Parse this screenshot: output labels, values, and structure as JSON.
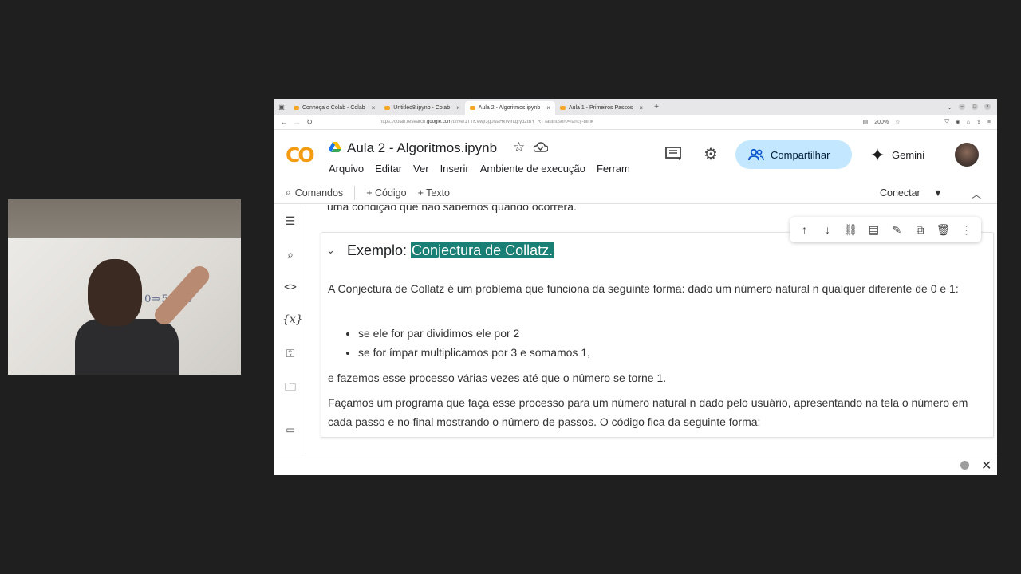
{
  "browser": {
    "tabs": [
      {
        "label": "Conheça o Colab - Colab",
        "active": false
      },
      {
        "label": "Untitled8.ipynb - Colab",
        "active": false
      },
      {
        "label": "Aula 2 - Algoritmos.ipynb",
        "active": true
      },
      {
        "label": "Aula 1 - Primeiros Passos",
        "active": false
      }
    ],
    "new_tab": "+",
    "url_prefix": "https://colab.research.",
    "url_domain": "google.com",
    "url_rest": "/drive/1TTKVwjf3g0NaHkWIntgryd2fBY_RT?authuser0=fancy-blink",
    "zoom": "200%"
  },
  "header": {
    "logo_text": "CO",
    "title": "Aula 2 - Algoritmos.ipynb",
    "menu": [
      "Arquivo",
      "Editar",
      "Ver",
      "Inserir",
      "Ambiente de execução",
      "Ferram"
    ],
    "share_label": "Compartilhar",
    "gemini_label": "Gemini",
    "accent_color": "#f9ab00",
    "share_bg": "#c2e7ff"
  },
  "toolbar": {
    "commands": "Comandos",
    "code": "+ Código",
    "text": "+ Texto",
    "connect": "Conectar"
  },
  "notebook": {
    "prev_line": "uma condição que não sabemos quando ocorrerá.",
    "heading_prefix": "Exemplo: ",
    "heading_highlight": "Conjectura de Collatz.",
    "para1": "A Conjectura de Collatz é um problema que funciona da seguinte forma: dado um número natural n qualquer diferente de 0 e 1:",
    "bullets": [
      "se ele for par dividimos ele por 2",
      "se for ímpar multiplicamos por 3 e somamos 1,"
    ],
    "para2": "e fazemos esse processo várias vezes até que o número se torne 1.",
    "para3": "Façamos um programa que faça esse processo para um número natural n dado pelo usuário, apresentando na tela o número em cada passo e no final mostrando o número de passos. O código fica da seguinte forma:"
  },
  "webcam": {
    "board_text": "⇒10⇒5⇒16"
  }
}
